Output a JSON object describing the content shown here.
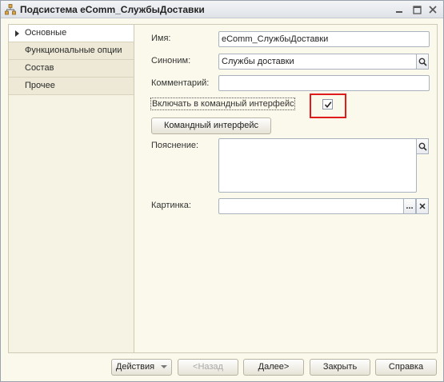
{
  "window": {
    "title": "Подсистема eComm_СлужбыДоставки"
  },
  "nav": {
    "items": [
      {
        "label": "Основные",
        "active": true
      },
      {
        "label": "Функциональные опции",
        "active": false
      },
      {
        "label": "Состав",
        "active": false
      },
      {
        "label": "Прочее",
        "active": false
      }
    ]
  },
  "form": {
    "name_label": "Имя:",
    "name_value": "eComm_СлужбыДоставки",
    "synonym_label": "Синоним:",
    "synonym_value": "Службы доставки",
    "comment_label": "Комментарий:",
    "comment_value": "",
    "include_label": "Включать в командный интерфейс",
    "include_checked": true,
    "command_interface_button": "Командный интерфейс",
    "explanation_label": "Пояснение:",
    "explanation_value": "",
    "picture_label": "Картинка:",
    "picture_value": "",
    "picture_select_glyph": "...",
    "picture_clear_glyph": "✕"
  },
  "footer": {
    "actions_label": "Действия",
    "back_label": "<Назад",
    "next_label": "Далее>",
    "close_label": "Закрыть",
    "help_label": "Справка"
  }
}
